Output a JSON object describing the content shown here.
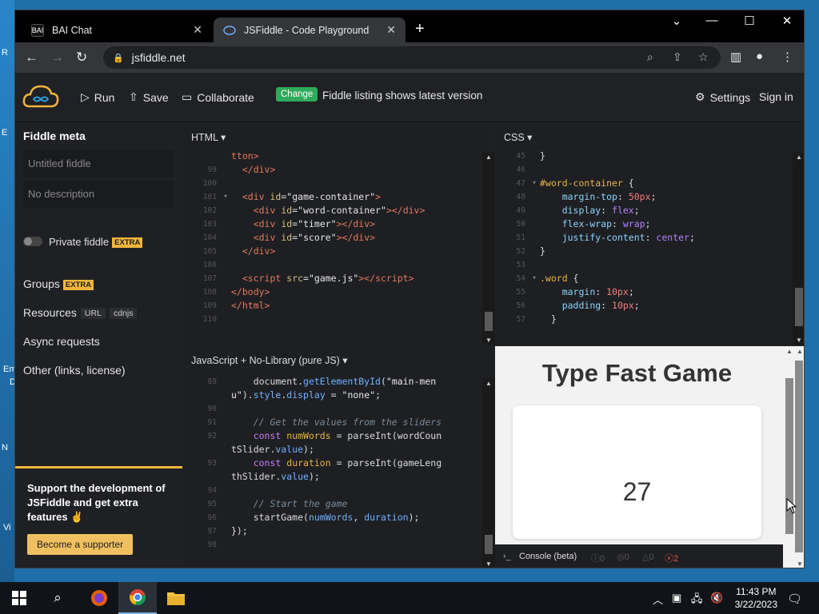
{
  "desktop": {
    "edge_labels": [
      "R",
      "E",
      "Em",
      "D",
      "N",
      "Vi"
    ]
  },
  "browser": {
    "tabs": [
      {
        "title": "BAI Chat",
        "favicon": "bai-favicon",
        "active": false
      },
      {
        "title": "JSFiddle - Code Playground",
        "favicon": "jsfiddle-favicon",
        "active": true
      }
    ],
    "new_tab": "+",
    "window_controls": {
      "dropdown": "⌄",
      "minimize": "—",
      "maximize": "☐",
      "close": "✕"
    },
    "url": "jsfiddle.net"
  },
  "header": {
    "run": "Run",
    "save": "Save",
    "collaborate": "Collaborate",
    "change_badge": "Change",
    "listing_text": "Fiddle listing shows latest version",
    "settings": "Settings",
    "sign_in": "Sign in"
  },
  "sidebar": {
    "title": "Fiddle meta",
    "title_placeholder": "Untitled fiddle",
    "description_placeholder": "No description",
    "private_label": "Private fiddle",
    "extra_badge": "EXTRA",
    "groups": "Groups",
    "resources": "Resources",
    "resources_chips": [
      "URL",
      "cdnjs"
    ],
    "async": "Async requests",
    "other": "Other (links, license)",
    "support_text": "Support the development of JSFiddle and get extra features ✌",
    "support_button": "Become a supporter"
  },
  "panels": {
    "html_title": "HTML ▾",
    "css_title": "CSS ▾",
    "js_title": "JavaScript + No-Library (pure JS) ▾"
  },
  "result": {
    "heading": "Type Fast Game",
    "number": "27",
    "console_label": "Console (beta)",
    "counts": [
      "0",
      "0",
      "0",
      "2"
    ]
  },
  "taskbar": {
    "time": "11:43 PM",
    "date": "3/22/2023"
  },
  "colors": {
    "change_green": "#2eaa5a",
    "extra_yellow": "#f0b53c",
    "error_red": "#e25555"
  }
}
